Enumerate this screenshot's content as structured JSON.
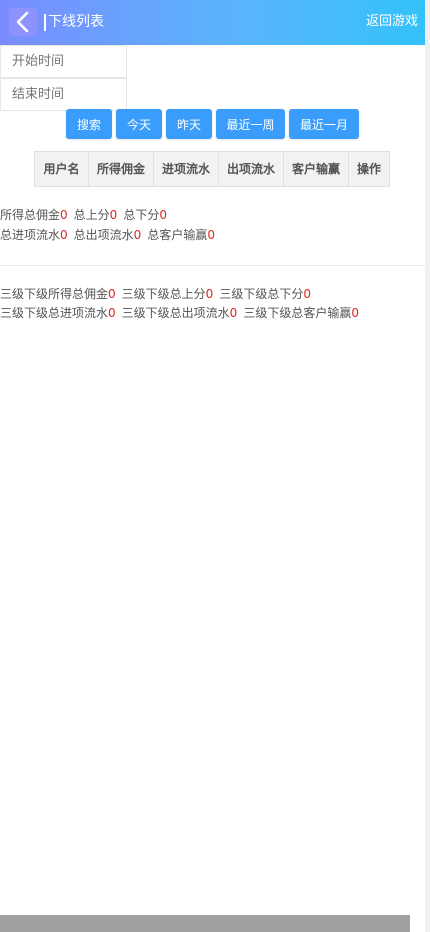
{
  "header": {
    "back_icon": "chevron-left-icon",
    "title": "下线列表",
    "return_label": "返回游戏"
  },
  "filters": {
    "start_placeholder": "开始时间",
    "end_placeholder": "结束时间"
  },
  "buttons": {
    "search": "搜索",
    "today": "今天",
    "yesterday": "昨天",
    "last_week": "最近一周",
    "last_month": "最近一月"
  },
  "table": {
    "headers": [
      "用户名",
      "所得佣金",
      "进项流水",
      "出项流水",
      "客户输赢",
      "操作"
    ]
  },
  "summary": {
    "commission_label": "所得总佣金",
    "commission_value": "0",
    "up_label": "总上分",
    "up_value": "0",
    "down_label": "总下分",
    "down_value": "0",
    "in_label": "总进项流水",
    "in_value": "0",
    "out_label": "总出项流水",
    "out_value": "0",
    "winloss_label": "总客户输赢",
    "winloss_value": "0"
  },
  "level3": {
    "commission_label": "三级下级所得总佣金",
    "commission_value": "0",
    "up_label": "三级下级总上分",
    "up_value": "0",
    "down_label": "三级下级总下分",
    "down_value": "0",
    "in_label": "三级下级总进项流水",
    "in_value": "0",
    "out_label": "三级下级总出项流水",
    "out_value": "0",
    "winloss_label": "三级下级总客户输赢",
    "winloss_value": "0"
  },
  "colors": {
    "header_gradient_start": "#7a8cff",
    "header_gradient_end": "#33c2fb",
    "button_blue": "#3a9dfb",
    "value_red": "#e02424"
  }
}
